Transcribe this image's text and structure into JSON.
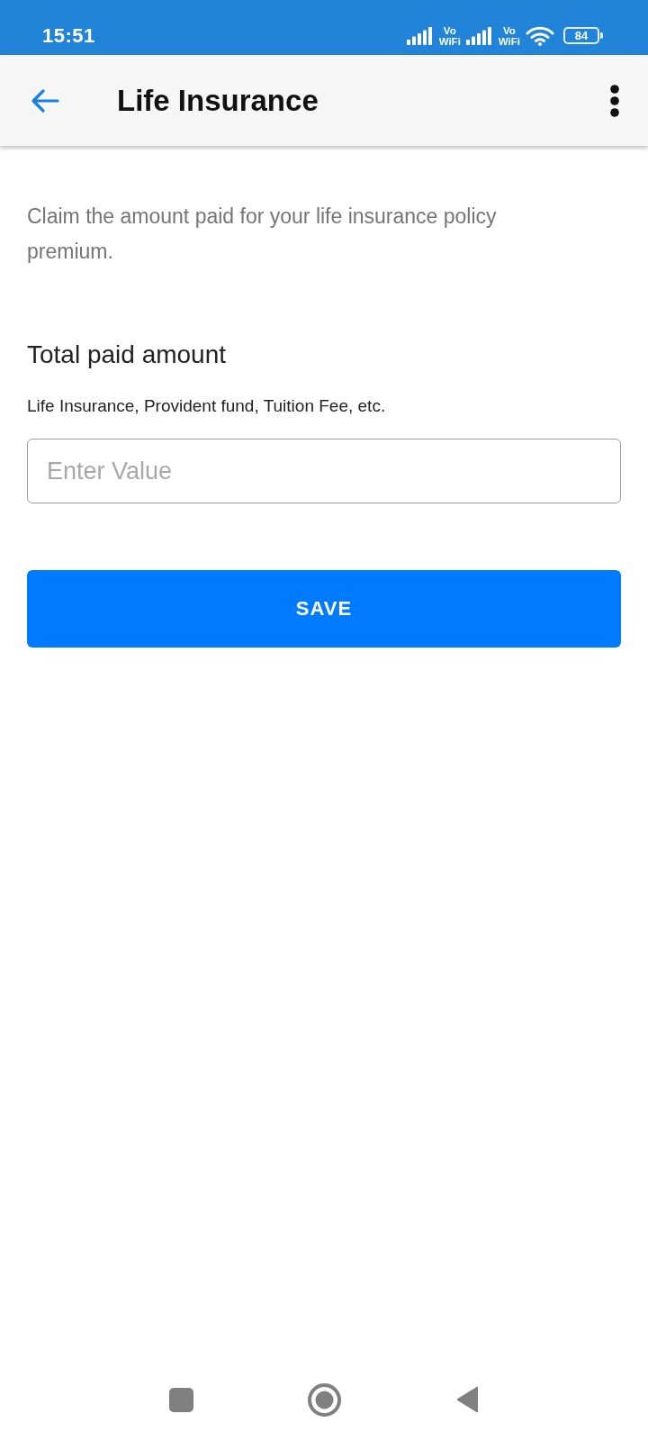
{
  "status_bar": {
    "time": "15:51",
    "icons": [
      {
        "kind": "signal"
      },
      {
        "kind": "vowifi",
        "line_1": "Vo",
        "line_2": "WiFi"
      },
      {
        "kind": "signal"
      },
      {
        "kind": "vowifi",
        "line_1": "Vo",
        "line_2": "WiFi"
      },
      {
        "kind": "wifi"
      },
      {
        "kind": "battery",
        "label": "84"
      }
    ]
  },
  "app_bar": {
    "title": "Life Insurance"
  },
  "description": "Claim the amount paid for your life insurance policy premium.",
  "field": {
    "label": "Total paid amount",
    "hint": "Life Insurance, Provident fund, Tuition Fee, etc.",
    "placeholder": "Enter Value"
  },
  "save_button": {
    "label": "SAVE"
  },
  "nav_bar": {
    "buttons": [
      {
        "kind": "recents"
      },
      {
        "kind": "home"
      },
      {
        "kind": "back"
      }
    ]
  }
}
